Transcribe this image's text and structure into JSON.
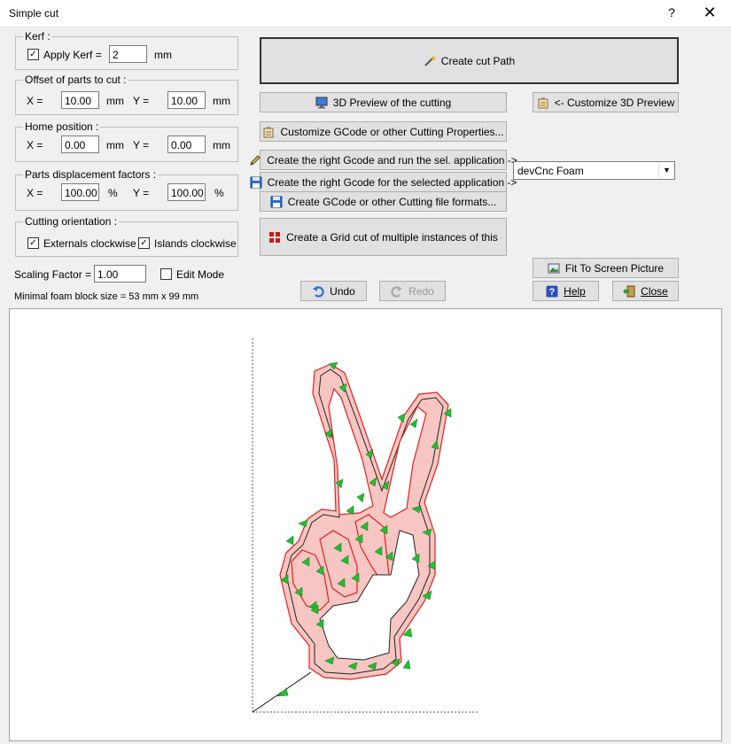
{
  "window": {
    "title": "Simple cut",
    "help_glyph": "?",
    "close_glyph": "✕"
  },
  "kerf": {
    "legend": "Kerf :",
    "apply_label": "Apply Kerf =",
    "apply_checked": true,
    "value": "2",
    "unit": "mm"
  },
  "offset": {
    "legend": "Offset of parts to cut :",
    "x_label": "X =",
    "x_value": "10.00",
    "x_unit": "mm",
    "y_label": "Y =",
    "y_value": "10.00",
    "y_unit": "mm"
  },
  "home": {
    "legend": "Home position :",
    "x_label": "X =",
    "x_value": "0.00",
    "x_unit": "mm",
    "y_label": "Y =",
    "y_value": "0.00",
    "y_unit": "mm"
  },
  "displacement": {
    "legend": "Parts displacement factors :",
    "x_label": "X =",
    "x_value": "100.00",
    "x_unit": "%",
    "y_label": "Y =",
    "y_value": "100.00",
    "y_unit": "%"
  },
  "orientation": {
    "legend": "Cutting orientation :",
    "externals_label": "Externals clockwise",
    "externals_checked": true,
    "islands_label": "Islands clockwise",
    "islands_checked": true
  },
  "scaling": {
    "label": "Scaling Factor =",
    "value": "1.00"
  },
  "edit_mode": {
    "label": "Edit Mode",
    "checked": false
  },
  "foam_info": "Minimal foam block size = 53 mm x 99 mm",
  "buttons": {
    "create_cut_path": "Create cut Path",
    "preview_3d": "3D Preview of the cutting",
    "customize_3d": "<- Customize 3D Preview",
    "customize_gcode": "Customize GCode or other Cutting Properties...",
    "gcode_run": "Create the right Gcode and run the sel. application ->",
    "gcode_selected": "Create the right Gcode for the selected application ->",
    "gcode_formats": "Create GCode or other Cutting file formats...",
    "grid_cut": "Create a Grid cut of multiple instances of this",
    "fit_screen": "Fit To Screen Picture",
    "undo": "Undo",
    "redo": "Redo",
    "help": "Help",
    "close": "Close"
  },
  "application_select": {
    "value": "devCnc Foam"
  },
  "colors": {
    "path_fill": "#f7c6c2",
    "kerf_line": "#e02020",
    "arrow": "#22c032"
  }
}
